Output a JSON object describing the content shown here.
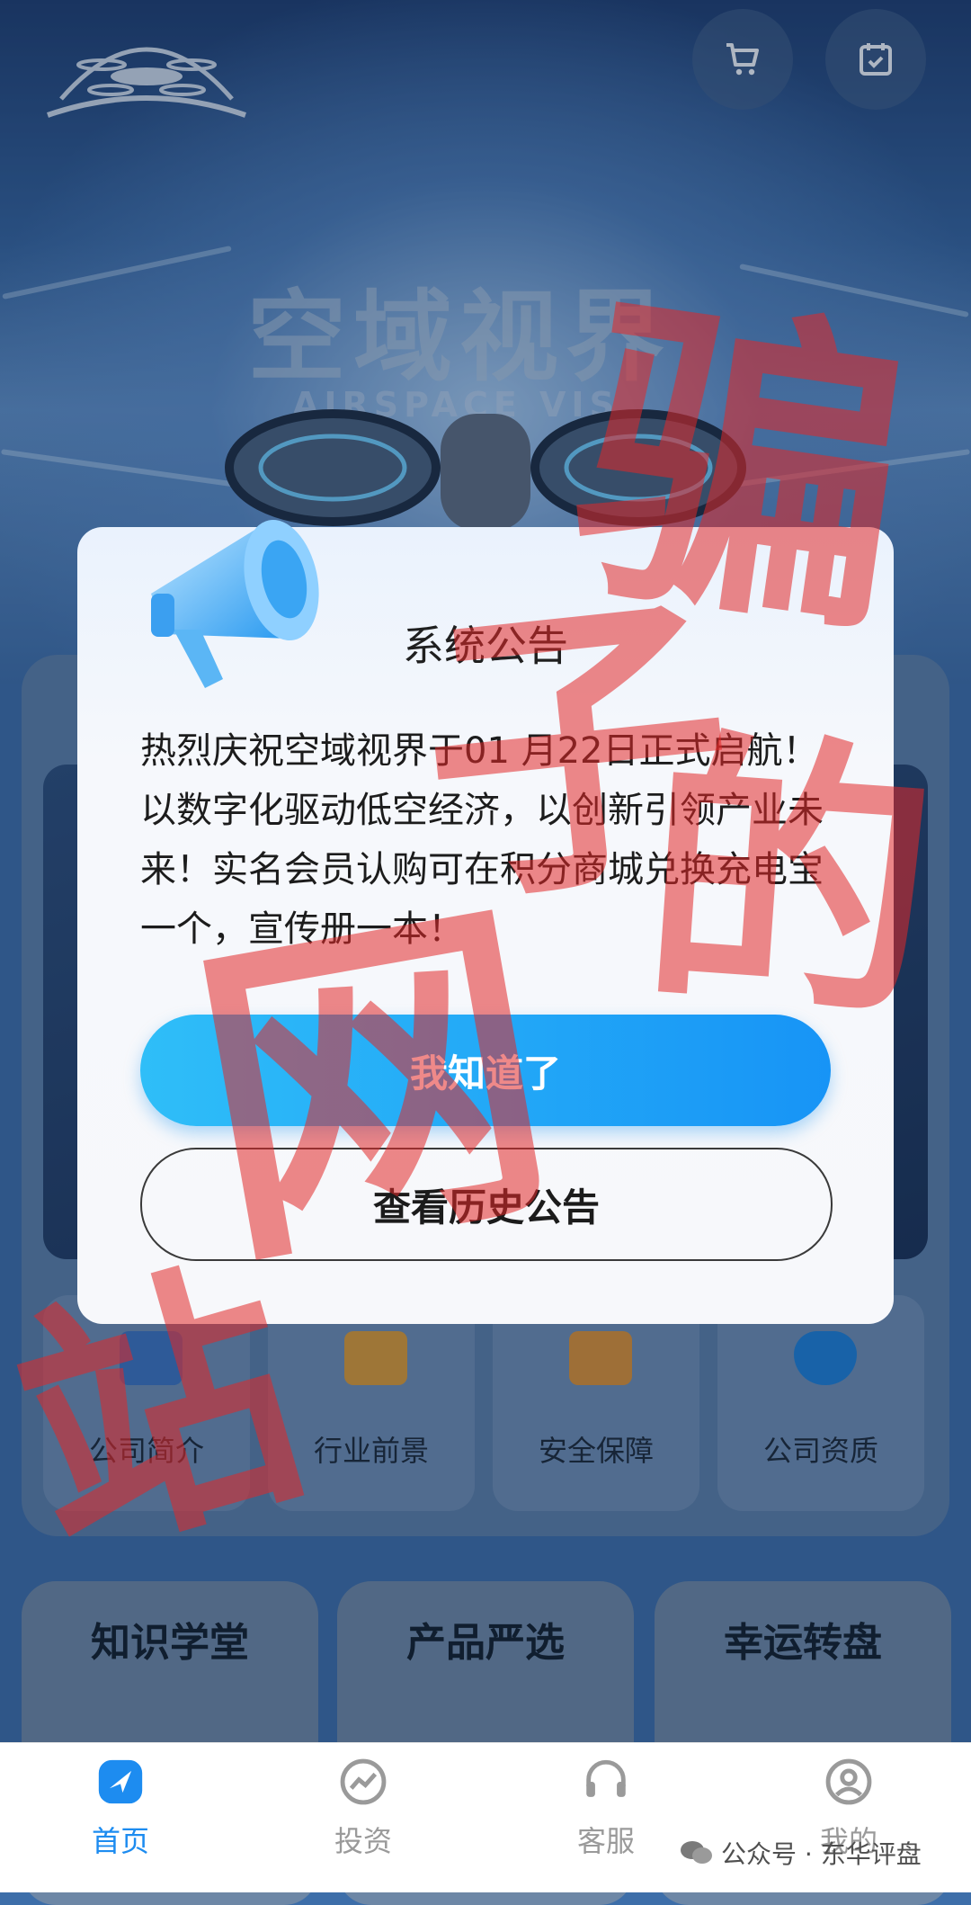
{
  "hero": {
    "title": "空域视界",
    "subtitle": "AIRSPACE VIS"
  },
  "header": {
    "cart_icon": "cart-icon",
    "checkin_icon": "calendar-check-icon"
  },
  "features": [
    {
      "label": "公司简介",
      "icon": "company-icon"
    },
    {
      "label": "行业前景",
      "icon": "chart-icon"
    },
    {
      "label": "安全保障",
      "icon": "wallet-icon"
    },
    {
      "label": "公司资质",
      "icon": "shield-icon"
    }
  ],
  "cards": [
    {
      "title": "知识学堂"
    },
    {
      "title": "产品严选"
    },
    {
      "title": "幸运转盘"
    }
  ],
  "modal": {
    "title": "系统公告",
    "body": "热烈庆祝空域视界于01 月22日正式启航！ 以数字化驱动低空经济，以创新引领产业未来！实名会员认购可在积分商城兑换充电宝一个，宣传册一本！",
    "primary_button": "我知道了",
    "secondary_button": "查看历史公告"
  },
  "stamps": {
    "line1": "骗",
    "line2": "子",
    "line3": "的",
    "line4": "网",
    "line5": "站"
  },
  "tabbar": {
    "items": [
      {
        "label": "首页",
        "icon": "home-icon",
        "active": true
      },
      {
        "label": "投资",
        "icon": "invest-icon",
        "active": false
      },
      {
        "label": "客服",
        "icon": "headset-icon",
        "active": false
      },
      {
        "label": "我的",
        "icon": "user-icon",
        "active": false
      }
    ],
    "active_color": "#1d8cf0",
    "inactive_color": "#9a9a9a"
  },
  "watermark": {
    "text": "公众号 · 东华评盘"
  }
}
